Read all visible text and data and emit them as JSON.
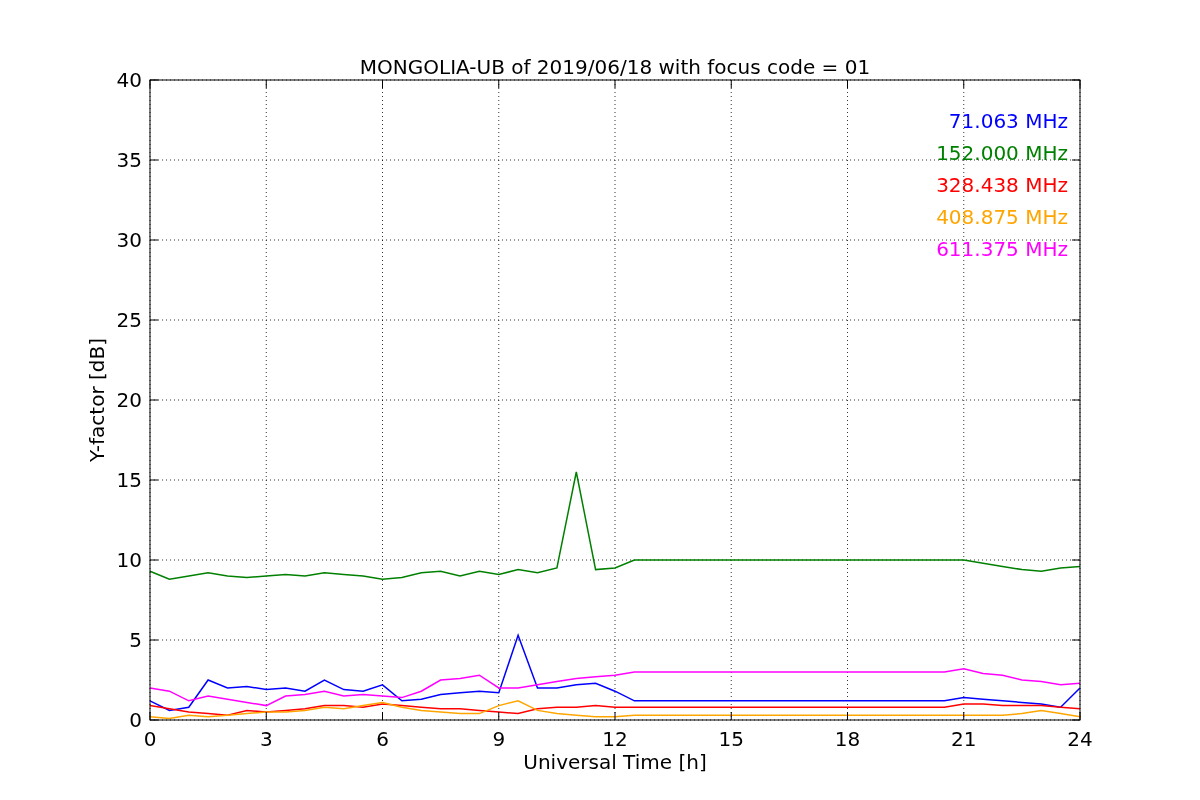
{
  "figure": {
    "chart_data": {
      "type": "line",
      "title": "MONGOLIA-UB of 2019/06/18 with focus code = 01",
      "xlabel": "Universal Time [h]",
      "ylabel": "Y-factor [dB]",
      "x": [
        0,
        0.5,
        1,
        1.5,
        2,
        2.5,
        3,
        3.5,
        4,
        4.5,
        5,
        5.5,
        6,
        6.5,
        7,
        7.5,
        8,
        8.5,
        9,
        9.5,
        10,
        10.5,
        11,
        11.5,
        12,
        12.5,
        13,
        13.5,
        14,
        14.5,
        15,
        15.5,
        16,
        16.5,
        17,
        17.5,
        18,
        18.5,
        19,
        19.5,
        20,
        20.5,
        21,
        21.5,
        22,
        22.5,
        23,
        23.5,
        24
      ],
      "series": [
        {
          "name": "71.063 MHz",
          "color": "#0000ff",
          "values": [
            1.2,
            0.6,
            0.8,
            2.5,
            2.0,
            2.1,
            1.9,
            2.0,
            1.8,
            2.5,
            1.9,
            1.8,
            2.2,
            1.2,
            1.3,
            1.6,
            1.7,
            1.8,
            1.7,
            5.3,
            2.0,
            2.0,
            2.2,
            2.3,
            1.8,
            1.2,
            1.2,
            1.2,
            1.2,
            1.2,
            1.2,
            1.2,
            1.2,
            1.2,
            1.2,
            1.2,
            1.2,
            1.2,
            1.2,
            1.2,
            1.2,
            1.2,
            1.4,
            1.3,
            1.2,
            1.1,
            1.0,
            0.8,
            2.0
          ]
        },
        {
          "name": "152.000 MHz",
          "color": "#008000",
          "values": [
            9.3,
            8.8,
            9.0,
            9.2,
            9.0,
            8.9,
            9.0,
            9.1,
            9.0,
            9.2,
            9.1,
            9.0,
            8.8,
            8.9,
            9.2,
            9.3,
            9.0,
            9.3,
            9.1,
            9.4,
            9.2,
            9.5,
            15.5,
            9.4,
            9.5,
            10.0,
            10.0,
            10.0,
            10.0,
            10.0,
            10.0,
            10.0,
            10.0,
            10.0,
            10.0,
            10.0,
            10.0,
            10.0,
            10.0,
            10.0,
            10.0,
            10.0,
            10.0,
            9.8,
            9.6,
            9.4,
            9.3,
            9.5,
            9.6
          ]
        },
        {
          "name": "328.438 MHz",
          "color": "#ff0000",
          "values": [
            0.9,
            0.7,
            0.5,
            0.4,
            0.3,
            0.6,
            0.5,
            0.6,
            0.7,
            0.9,
            0.9,
            0.8,
            1.0,
            0.9,
            0.8,
            0.7,
            0.7,
            0.6,
            0.5,
            0.4,
            0.7,
            0.8,
            0.8,
            0.9,
            0.8,
            0.8,
            0.8,
            0.8,
            0.8,
            0.8,
            0.8,
            0.8,
            0.8,
            0.8,
            0.8,
            0.8,
            0.8,
            0.8,
            0.8,
            0.8,
            0.8,
            0.8,
            1.0,
            1.0,
            0.9,
            0.9,
            0.9,
            0.8,
            0.7
          ]
        },
        {
          "name": "408.875 MHz",
          "color": "#ffa500",
          "values": [
            0.2,
            0.1,
            0.3,
            0.2,
            0.3,
            0.4,
            0.5,
            0.5,
            0.6,
            0.8,
            0.7,
            0.9,
            1.1,
            0.8,
            0.6,
            0.5,
            0.4,
            0.4,
            0.9,
            1.2,
            0.6,
            0.4,
            0.3,
            0.2,
            0.2,
            0.3,
            0.3,
            0.3,
            0.3,
            0.3,
            0.3,
            0.3,
            0.3,
            0.3,
            0.3,
            0.3,
            0.3,
            0.3,
            0.3,
            0.3,
            0.3,
            0.3,
            0.3,
            0.3,
            0.3,
            0.4,
            0.6,
            0.4,
            0.2
          ]
        },
        {
          "name": "611.375 MHz",
          "color": "#ff00ff",
          "values": [
            2.0,
            1.8,
            1.2,
            1.5,
            1.3,
            1.1,
            0.9,
            1.5,
            1.6,
            1.8,
            1.5,
            1.6,
            1.5,
            1.4,
            1.8,
            2.5,
            2.6,
            2.8,
            2.0,
            2.0,
            2.2,
            2.4,
            2.6,
            2.7,
            2.8,
            3.0,
            3.0,
            3.0,
            3.0,
            3.0,
            3.0,
            3.0,
            3.0,
            3.0,
            3.0,
            3.0,
            3.0,
            3.0,
            3.0,
            3.0,
            3.0,
            3.0,
            3.2,
            2.9,
            2.8,
            2.5,
            2.4,
            2.2,
            2.3
          ]
        }
      ],
      "grid": true,
      "xlim": [
        0,
        24
      ],
      "ylim": [
        0,
        40
      ],
      "xticks": [
        0,
        3,
        6,
        9,
        12,
        15,
        18,
        21,
        24
      ],
      "yticks": [
        0,
        5,
        10,
        15,
        20,
        25,
        30,
        35,
        40
      ]
    }
  }
}
